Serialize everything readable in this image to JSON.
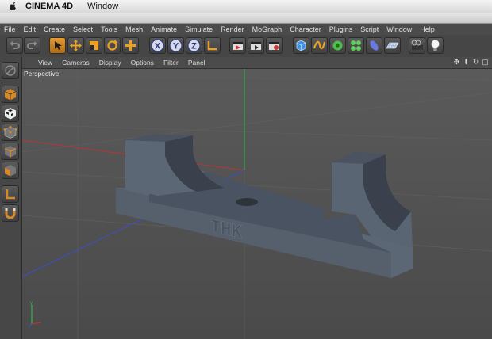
{
  "mac_menu": {
    "app_name": "CINEMA 4D",
    "items": [
      "Window"
    ]
  },
  "menubar": {
    "items": [
      "File",
      "Edit",
      "Create",
      "Select",
      "Tools",
      "Mesh",
      "Animate",
      "Simulate",
      "Render",
      "MoGraph",
      "Character",
      "Plugins",
      "Script",
      "Window",
      "Help"
    ]
  },
  "toolbar": {
    "tools": [
      {
        "name": "undo-icon"
      },
      {
        "name": "redo-icon"
      },
      {
        "name": "live-select-icon"
      },
      {
        "name": "move-icon"
      },
      {
        "name": "scale-icon"
      },
      {
        "name": "rotate-icon"
      },
      {
        "name": "add-icon"
      },
      {
        "name": "x-axis-icon",
        "label": "X"
      },
      {
        "name": "y-axis-icon",
        "label": "Y"
      },
      {
        "name": "z-axis-icon",
        "label": "Z"
      },
      {
        "name": "coordinate-system-icon"
      },
      {
        "name": "render-view-icon"
      },
      {
        "name": "render-picture-viewer-icon"
      },
      {
        "name": "render-settings-icon"
      },
      {
        "name": "cube-icon"
      },
      {
        "name": "spline-icon"
      },
      {
        "name": "nurbs-icon"
      },
      {
        "name": "array-icon"
      },
      {
        "name": "deformer-icon"
      },
      {
        "name": "floor-icon"
      },
      {
        "name": "camera-icon"
      },
      {
        "name": "light-icon"
      }
    ]
  },
  "left_tools": [
    {
      "name": "make-editable-icon"
    },
    {
      "name": "model-mode-icon"
    },
    {
      "name": "texture-mode-icon"
    },
    {
      "name": "point-mode-icon"
    },
    {
      "name": "edge-mode-icon"
    },
    {
      "name": "polygon-mode-icon"
    },
    {
      "name": "workplane-icon"
    },
    {
      "name": "snap-icon"
    }
  ],
  "viewport_menu": {
    "items": [
      "View",
      "Cameras",
      "Display",
      "Options",
      "Filter",
      "Panel"
    ]
  },
  "viewport": {
    "label": "Perspective",
    "model_text": "THK"
  },
  "colors": {
    "accent_orange": "#d7882a",
    "axis_x": "#c03030",
    "axis_y": "#2fb84a",
    "axis_z": "#3a4fd0",
    "model": "#5d6878"
  }
}
